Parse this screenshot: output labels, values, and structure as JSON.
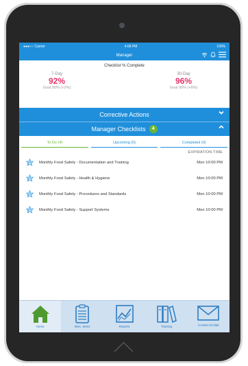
{
  "status_bar": {
    "carrier": "●●●○○ Carrier",
    "time": "4:08 PM",
    "battery": "100%"
  },
  "nav": {
    "title": "Manager"
  },
  "summary": {
    "title": "Checklist % Complete",
    "seven_day": {
      "label": "7-Day",
      "percent": "92%",
      "goal": "Goal 90% (+2%)"
    },
    "thirty_day": {
      "label": "30-Day",
      "percent": "96%",
      "goal": "Goal 90% (+6%)"
    }
  },
  "corrective_actions": {
    "label": "Corrective Actions"
  },
  "manager_checklists": {
    "label": "Manager Checklists",
    "count": "4"
  },
  "tabs": [
    {
      "label": "To Do (4)"
    },
    {
      "label": "Upcoming (0)"
    },
    {
      "label": "Completed (0)"
    }
  ],
  "list_header": {
    "expiration": "EXPIRATION TIME"
  },
  "checklists": [
    {
      "name": "Monthly Food Safety - Documentation and Training",
      "time": "Mon 10:00 PM"
    },
    {
      "name": "Monthly Food Safety - Health & Hygiene",
      "time": "Mon 10:00 PM"
    },
    {
      "name": "Monthly Food Safety - Procedures and Standards",
      "time": "Mon 10:00 PM"
    },
    {
      "name": "Monthly Food Safety - Support Systems",
      "time": "Mon 10:00 PM"
    }
  ],
  "tabbar": [
    {
      "label": "Home",
      "icon": "home-icon"
    },
    {
      "label": "Misc. Items",
      "icon": "clipboard-icon"
    },
    {
      "label": "Reports",
      "icon": "chart-icon"
    },
    {
      "label": "Training",
      "icon": "binders-icon"
    },
    {
      "label": "Contact Ecolab",
      "icon": "envelope-icon"
    }
  ],
  "colors": {
    "primary": "#1f8fdb",
    "accent_green": "#6bb536",
    "percent": "#e8336b",
    "tabbar": "#cfe0f1"
  }
}
